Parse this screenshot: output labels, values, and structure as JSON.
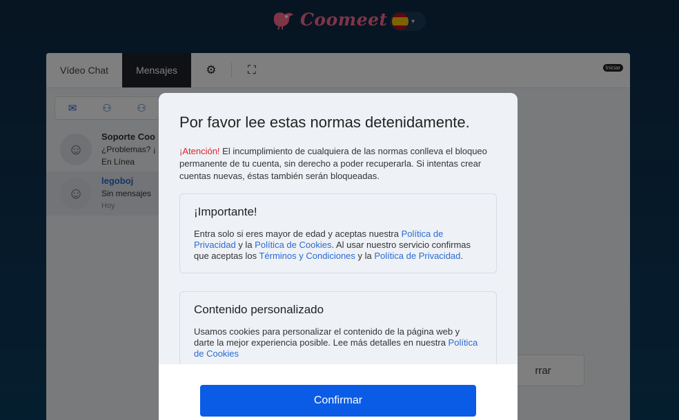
{
  "header": {
    "brand": "Coomeet",
    "language_flag": "es-flag",
    "language_chevron": "chevron-down-icon"
  },
  "app": {
    "tabs": [
      {
        "label": "Vídeo Chat",
        "active": false
      },
      {
        "label": "Mensajes",
        "active": true
      }
    ],
    "iniciar_badge": "Iniciar",
    "chats": [
      {
        "name": "Soporte Coo",
        "preview": "¿Problemas? ¡",
        "status": "En Línea"
      },
      {
        "name": "legoboj",
        "preview": "Sin mensajes",
        "status": "Hoy"
      }
    ],
    "side_button": "rrar"
  },
  "modal": {
    "title": "Por favor lee estas normas detenidamente.",
    "warning_prefix": "¡Atención!",
    "warning_text": " El incumplimiento de cualquiera de las normas conlleva el bloqueo permanente de tu cuenta, sin derecho a poder recuperarla. Si intentas crear cuentas nuevas, éstas también serán bloqueadas.",
    "important": {
      "heading": "¡Importante!",
      "t1": "Entra solo si eres mayor de edad y aceptas nuestra ",
      "link_privacy": "Política de Privacidad",
      "t2": " y la ",
      "link_cookies": "Política de Cookies",
      "t3": ". Al usar nuestro servicio confirmas que aceptas los ",
      "link_terms": "Términos y Condiciones",
      "t4": " y la ",
      "link_privacy2": "Política de Privacidad",
      "t5": "."
    },
    "personalized": {
      "heading": "Contenido personalizado",
      "text": "Usamos cookies para personalizar el contenido de la página web y darte la mejor experiencia posible. Lee más detalles en nuestra ",
      "link_cookies": "Política de Cookies"
    },
    "confirm_label": "Confirmar"
  },
  "colors": {
    "accent": "#0a5ce6",
    "link": "#2a6bd1",
    "warning": "#e01f2d",
    "brand": "#ff6b8f"
  }
}
